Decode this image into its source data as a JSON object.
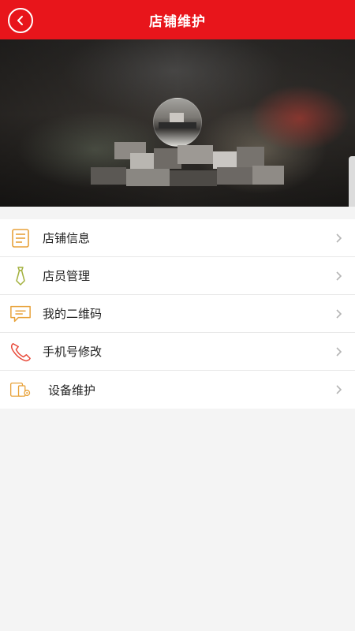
{
  "header": {
    "title": "店铺维护",
    "back_icon": "chevron-left-circle-icon"
  },
  "colors": {
    "brand_red": "#e8151b",
    "icon_orange": "#e8a23a",
    "icon_green": "#a3b13f",
    "chevron_gray": "#b5b5b5"
  },
  "menu": {
    "items": [
      {
        "label": "店铺信息",
        "icon": "document-icon"
      },
      {
        "label": "店员管理",
        "icon": "tie-icon"
      },
      {
        "label": "我的二维码",
        "icon": "message-icon"
      },
      {
        "label": "手机号修改",
        "icon": "phone-icon"
      },
      {
        "label": "设备维护",
        "icon": "device-settings-icon"
      }
    ]
  }
}
